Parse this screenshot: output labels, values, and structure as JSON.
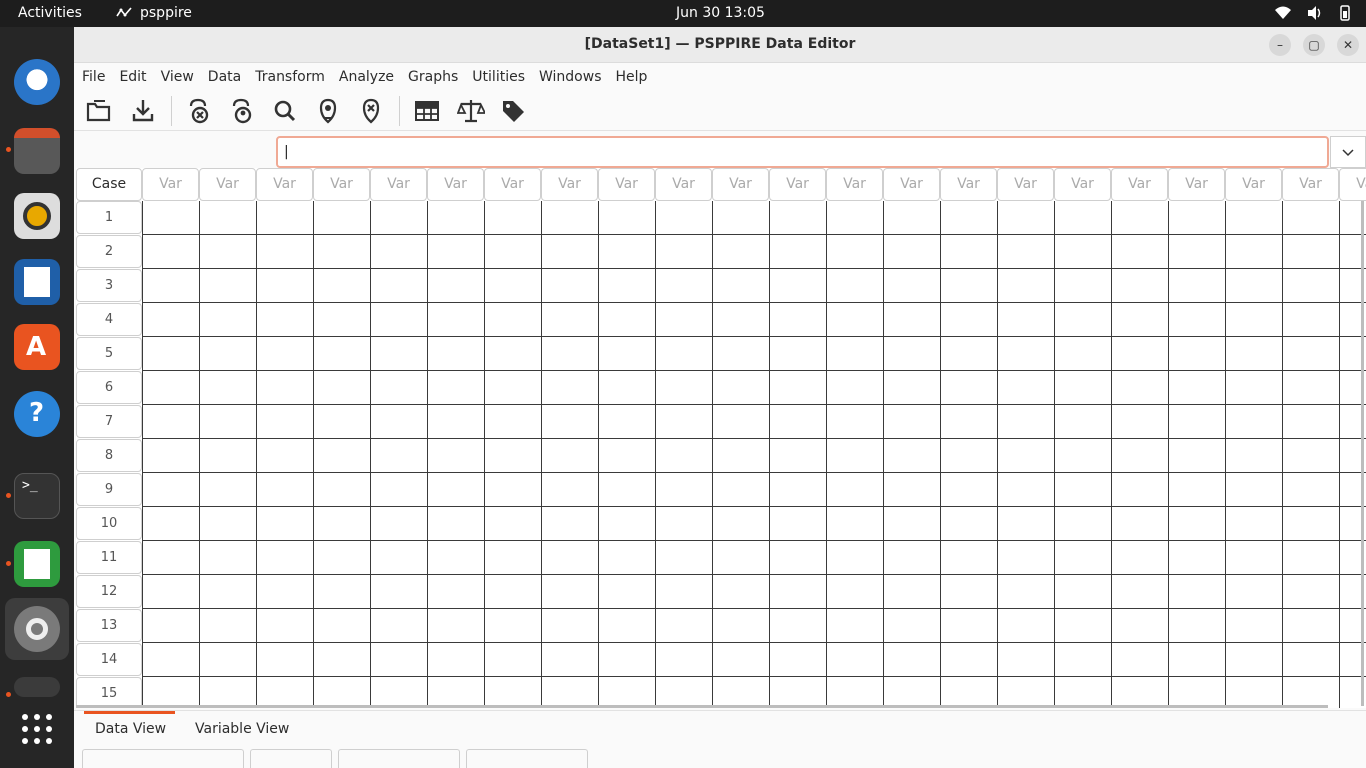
{
  "topbar": {
    "activities": "Activities",
    "app_name": "psppire",
    "clock": "Jun 30  13:05"
  },
  "dock": {
    "items": [
      "thunderbird-icon",
      "files-icon",
      "rhythmbox-icon",
      "writer-icon",
      "app-center-icon",
      "help-icon",
      "terminal-icon",
      "calc-icon",
      "settings-icon",
      "extra-app-icon",
      "show-apps-icon"
    ]
  },
  "window": {
    "title": "[DataSet1] — PSPPIRE Data Editor",
    "minimize": "–",
    "maximize": "▢",
    "close": "✕"
  },
  "menubar": {
    "items": [
      "File",
      "Edit",
      "View",
      "Data",
      "Transform",
      "Analyze",
      "Graphs",
      "Utilities",
      "Windows",
      "Help"
    ]
  },
  "input": {
    "value": "|"
  },
  "grid": {
    "case_header": "Case",
    "var_header": "Var",
    "rows": [
      "1",
      "2",
      "3",
      "4",
      "5",
      "6",
      "7",
      "8",
      "9",
      "10",
      "11",
      "12",
      "13",
      "14",
      "15"
    ]
  },
  "tabs": {
    "data_view": "Data View",
    "variable_view": "Variable View"
  },
  "colors": {
    "accent": "#e95420",
    "topbar": "#1d1d1d",
    "dock": "#262626"
  }
}
